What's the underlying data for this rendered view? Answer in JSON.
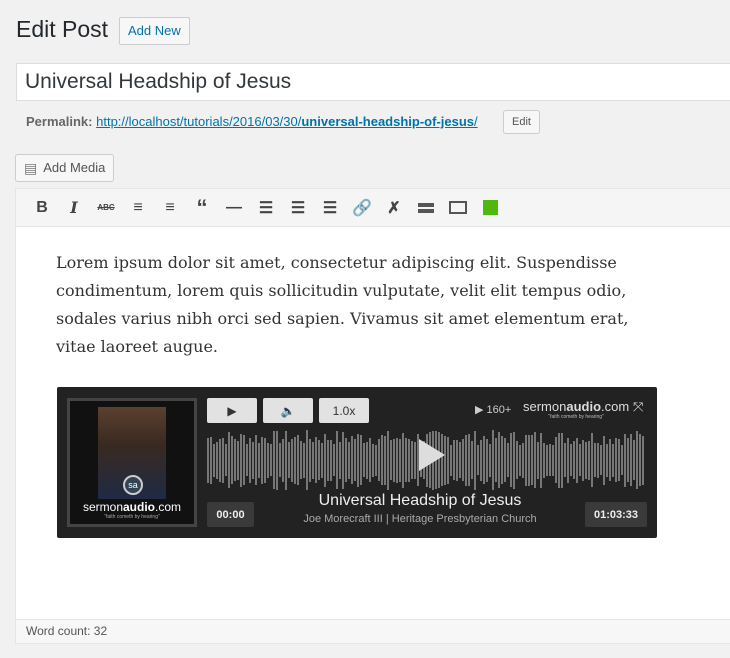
{
  "page": {
    "title": "Edit Post",
    "add_new": "Add New"
  },
  "post": {
    "title": "Universal Headship of Jesus"
  },
  "permalink": {
    "label": "Permalink:",
    "url_base": "http://localhost/tutorials/2016/03/30/",
    "slug": "universal-headship-of-jesus",
    "slash": "/",
    "edit": "Edit"
  },
  "editor": {
    "add_media": "Add Media",
    "toolbar": [
      "bold",
      "italic",
      "strikethrough",
      "bulleted-list",
      "numbered-list",
      "blockquote",
      "horizontal-line",
      "align-left",
      "align-center",
      "align-right",
      "insert-link",
      "remove-link",
      "read-more",
      "toolbar-toggle",
      "color"
    ],
    "content": "Lorem ipsum dolor sit amet, consectetur adipiscing elit. Suspendisse condimentum, lorem quis sollicitudin vulputate, velit elit tempus odio, sodales varius nibh orci sed sapien. Vivamus sit amet elementum erat, vitae laoreet augue.",
    "word_count": "Word count: 32"
  },
  "player": {
    "speed": "1.0x",
    "plays": "160+",
    "brand_a": "sermon",
    "brand_b": "audio",
    "brand_c": ".com",
    "tagline": "\"faith cometh by hearing\"",
    "current_time": "00:00",
    "duration": "01:03:33",
    "title": "Universal Headship of Jesus",
    "subtitle": "Joe Morecraft III | Heritage Presbyterian Church",
    "logo_badge": "sa"
  }
}
